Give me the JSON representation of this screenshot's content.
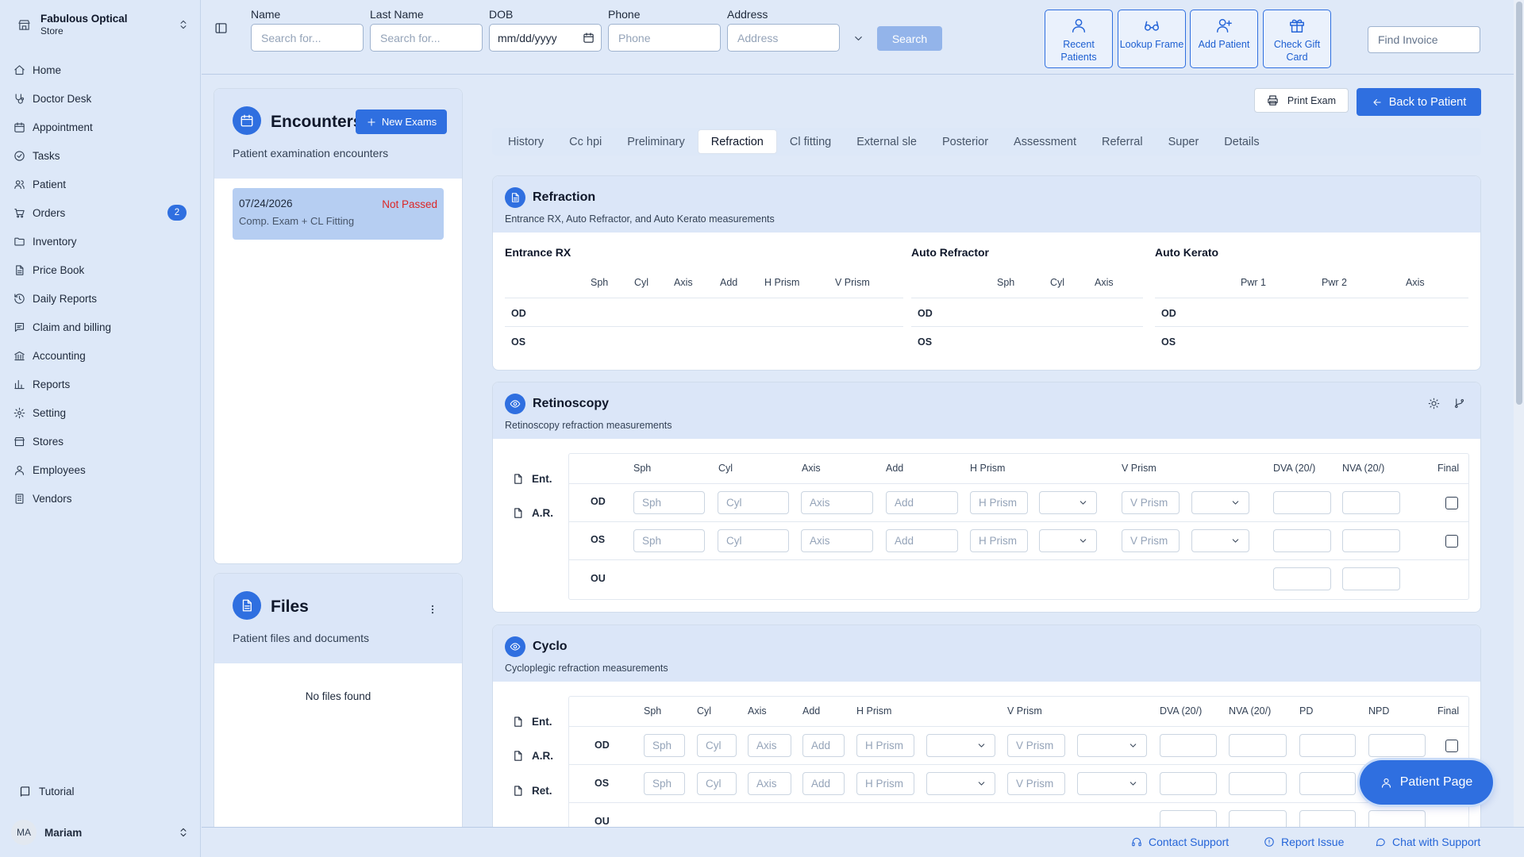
{
  "store": {
    "name": "Fabulous Optical",
    "sub": "Store"
  },
  "nav": [
    {
      "label": "Home",
      "icon": "home-icon"
    },
    {
      "label": "Doctor Desk",
      "icon": "stethoscope-icon"
    },
    {
      "label": "Appointment",
      "icon": "calendar-icon"
    },
    {
      "label": "Tasks",
      "icon": "check-circle-icon"
    },
    {
      "label": "Patient",
      "icon": "users-icon"
    },
    {
      "label": "Orders",
      "icon": "cart-icon",
      "badge": "2"
    },
    {
      "label": "Inventory",
      "icon": "folder-icon"
    },
    {
      "label": "Price Book",
      "icon": "file-icon"
    },
    {
      "label": "Daily Reports",
      "icon": "history-icon"
    },
    {
      "label": "Claim and billing",
      "icon": "message-icon"
    },
    {
      "label": "Accounting",
      "icon": "bank-icon"
    },
    {
      "label": "Reports",
      "icon": "bar-chart-icon"
    },
    {
      "label": "Setting",
      "icon": "gear-icon"
    },
    {
      "label": "Stores",
      "icon": "store-icon"
    },
    {
      "label": "Employees",
      "icon": "user-icon"
    },
    {
      "label": "Vendors",
      "icon": "building-icon"
    }
  ],
  "tutorial": "Tutorial",
  "user": {
    "initials": "MA",
    "name": "Mariam"
  },
  "search": {
    "name": {
      "label": "Name",
      "placeholder": "Search for..."
    },
    "last_name": {
      "label": "Last Name",
      "placeholder": "Search for..."
    },
    "dob": {
      "label": "DOB",
      "value": "mm/dd/yyyy"
    },
    "phone": {
      "label": "Phone",
      "placeholder": "Phone"
    },
    "address": {
      "label": "Address",
      "placeholder": "Address"
    },
    "button": "Search"
  },
  "quick_actions": {
    "recent": "Recent Patients",
    "lookup": "Lookup Frame",
    "add": "Add Patient",
    "gift": "Check Gift Card"
  },
  "find_invoice": "Find Invoice",
  "encounters": {
    "title": "Encounters",
    "subtitle": "Patient examination encounters",
    "new_button": "New Exams",
    "items": [
      {
        "date": "07/24/2026",
        "status": "Not Passed",
        "description": "Comp. Exam + CL Fitting"
      }
    ]
  },
  "files": {
    "title": "Files",
    "subtitle": "Patient files and documents",
    "empty": "No files found"
  },
  "actions": {
    "print": "Print Exam",
    "back": "Back to Patient"
  },
  "tabs": [
    "History",
    "Cc hpi",
    "Preliminary",
    "Refraction",
    "Cl fitting",
    "External sle",
    "Posterior",
    "Assessment",
    "Referral",
    "Super",
    "Details"
  ],
  "active_tab": "Refraction",
  "refraction": {
    "title": "Refraction",
    "subtitle": "Entrance RX, Auto Refractor, and Auto Kerato measurements",
    "entrance": {
      "title": "Entrance RX",
      "columns": [
        "Sph",
        "Cyl",
        "Axis",
        "Add",
        "H Prism",
        "V Prism"
      ]
    },
    "auto_refractor": {
      "title": "Auto Refractor",
      "columns": [
        "Sph",
        "Cyl",
        "Axis"
      ]
    },
    "auto_kerato": {
      "title": "Auto Kerato",
      "columns": [
        "Pwr 1",
        "Pwr 2",
        "Axis"
      ]
    },
    "rows": [
      "OD",
      "OS"
    ]
  },
  "retinoscopy": {
    "title": "Retinoscopy",
    "subtitle": "Retinoscopy refraction measurements",
    "side": [
      "Ent.",
      "A.R."
    ],
    "columns": [
      "Sph",
      "Cyl",
      "Axis",
      "Add",
      "H Prism",
      "V Prism",
      "DVA (20/)",
      "NVA (20/)",
      "Final"
    ],
    "placeholders": {
      "sph": "Sph",
      "cyl": "Cyl",
      "axis": "Axis",
      "add": "Add",
      "hprism": "H Prism",
      "vprism": "V Prism"
    },
    "rows": [
      "OD",
      "OS",
      "OU"
    ]
  },
  "cyclo": {
    "title": "Cyclo",
    "subtitle": "Cycloplegic refraction measurements",
    "side": [
      "Ent.",
      "A.R.",
      "Ret."
    ],
    "columns": [
      "Sph",
      "Cyl",
      "Axis",
      "Add",
      "H Prism",
      "V Prism",
      "DVA (20/)",
      "NVA (20/)",
      "PD",
      "NPD",
      "Final"
    ],
    "rows": [
      "OD",
      "OS",
      "OU"
    ]
  },
  "footer": {
    "contact": "Contact Support",
    "report": "Report Issue",
    "chat": "Chat with Support"
  },
  "fab": "Patient Page",
  "colors": {
    "accent": "#2f6fe0",
    "panel_header": "#dbe6f8",
    "status_fail": "#dc2626",
    "background": "#dfe9f8"
  }
}
